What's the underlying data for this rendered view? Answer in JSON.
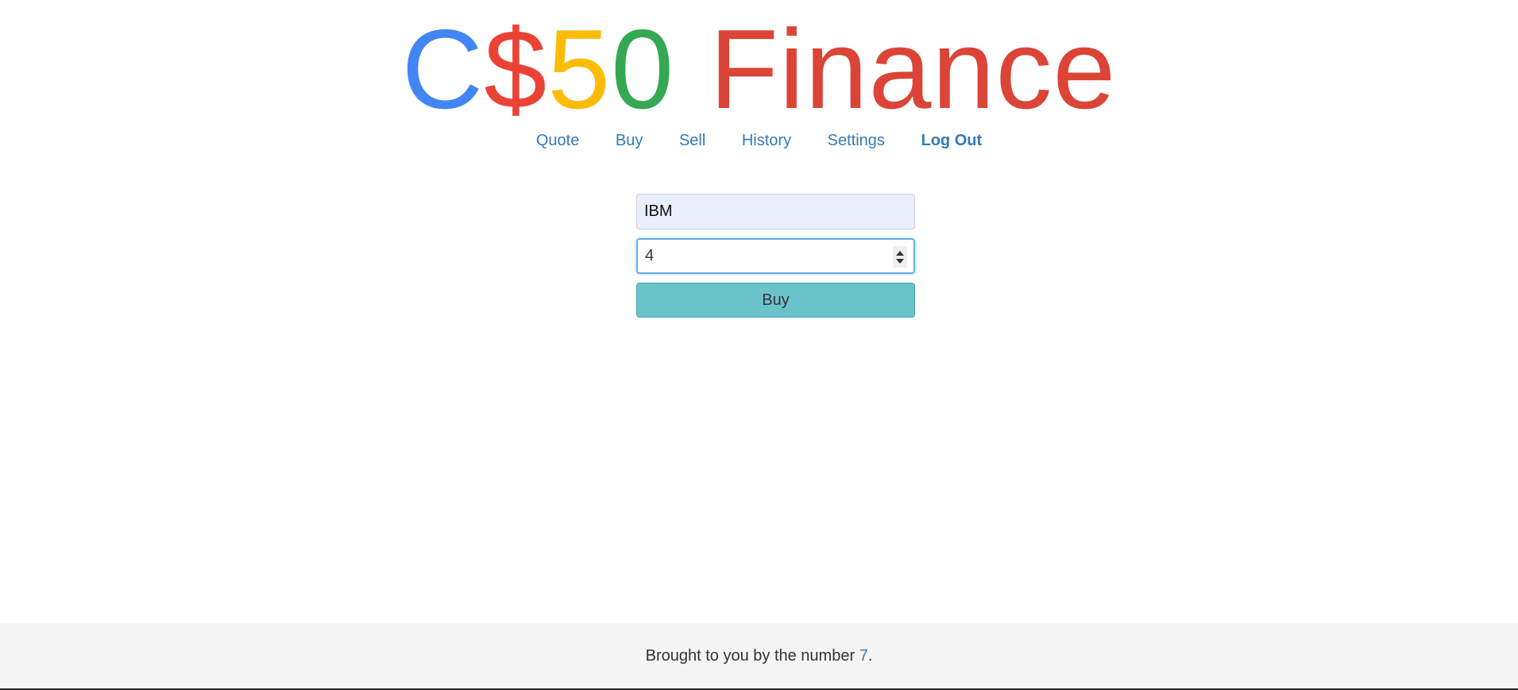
{
  "logo": {
    "parts": [
      {
        "text": "C",
        "color": "#4285f4"
      },
      {
        "text": "$",
        "color": "#ea4335"
      },
      {
        "text": "5",
        "color": "#fbbc05"
      },
      {
        "text": "0",
        "color": "#34a853"
      },
      {
        "text": "Finance",
        "color": "#db4437"
      }
    ]
  },
  "nav": {
    "items": [
      {
        "label": "Quote"
      },
      {
        "label": "Buy"
      },
      {
        "label": "Sell"
      },
      {
        "label": "History"
      },
      {
        "label": "Settings"
      },
      {
        "label": "Log Out"
      }
    ],
    "link_color": "#337ab7"
  },
  "form": {
    "symbol_value": "IBM",
    "shares_value": "4",
    "buy_label": "Buy",
    "button_color": "#6cc4cb"
  },
  "footer": {
    "text": "Brought to you by the number ",
    "number": "7",
    "period": "."
  }
}
